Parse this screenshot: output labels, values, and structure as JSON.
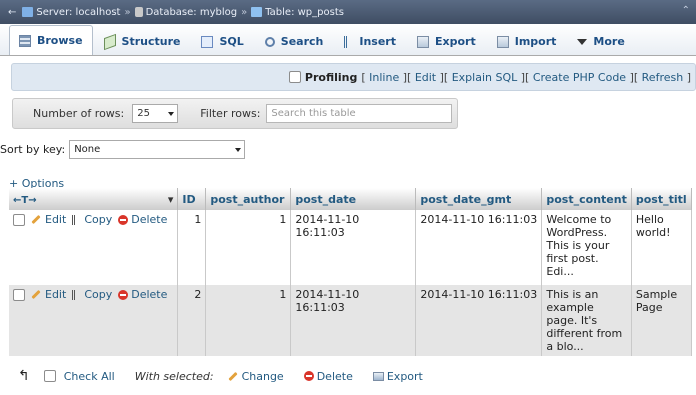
{
  "breadcrumb": {
    "server": "Server: localhost",
    "database": "Database: myblog",
    "table": "Table: wp_posts",
    "separator": "»"
  },
  "tabs": [
    {
      "label": "Browse",
      "icon": "browse-icon"
    },
    {
      "label": "Structure",
      "icon": "structure-icon"
    },
    {
      "label": "SQL",
      "icon": "sql-icon"
    },
    {
      "label": "Search",
      "icon": "search-icon"
    },
    {
      "label": "Insert",
      "icon": "insert-icon"
    },
    {
      "label": "Export",
      "icon": "export-icon"
    },
    {
      "label": "Import",
      "icon": "import-icon"
    },
    {
      "label": "More",
      "icon": "dropdown-icon"
    }
  ],
  "profiling": {
    "label": "Profiling",
    "links": [
      "Inline",
      "Edit",
      "Explain SQL",
      "Create PHP Code",
      "Refresh"
    ]
  },
  "rows": {
    "number_label": "Number of rows:",
    "number_value": "25",
    "filter_label": "Filter rows:",
    "filter_placeholder": "Search this table"
  },
  "sort": {
    "label": "Sort by key:",
    "value": "None"
  },
  "options_link": "+ Options",
  "table": {
    "sort_arrows": "←T→",
    "columns": [
      "ID",
      "post_author",
      "post_date",
      "post_date_gmt",
      "post_content",
      "post_titl"
    ],
    "row_actions": {
      "edit": "Edit",
      "copy": "Copy",
      "delete": "Delete"
    },
    "rows": [
      {
        "id": "1",
        "post_author": "1",
        "post_date": "2014-11-10 16:11:03",
        "post_date_gmt": "2014-11-10 16:11:03",
        "post_content": "Welcome to WordPress. This is your first post. Edi...",
        "post_title": "Hello world!"
      },
      {
        "id": "2",
        "post_author": "1",
        "post_date": "2014-11-10 16:11:03",
        "post_date_gmt": "2014-11-10 16:11:03",
        "post_content": "This is an example page. It's different from a blo...",
        "post_title": "Sample Page"
      }
    ]
  },
  "bottom": {
    "check_all": "Check All",
    "with_selected": "With selected:",
    "change": "Change",
    "delete": "Delete",
    "export": "Export"
  }
}
